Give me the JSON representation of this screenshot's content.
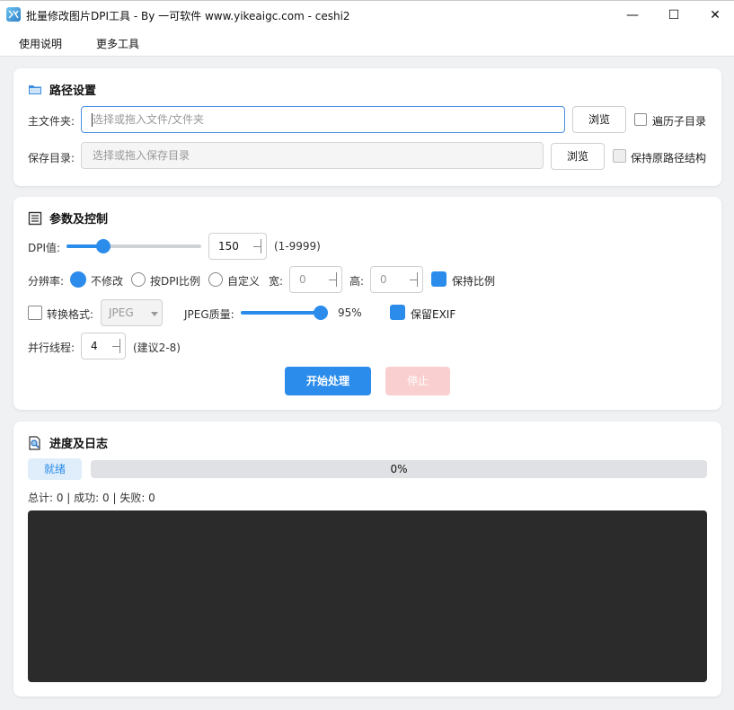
{
  "window": {
    "title": "批量修改图片DPI工具 - By 一可软件 www.yikeaigc.com - ceshi2",
    "minimize_glyph": "—",
    "maximize_glyph": "☐",
    "close_glyph": "✕"
  },
  "menu": {
    "items": [
      "使用说明",
      "更多工具"
    ]
  },
  "path_section": {
    "title": "路径设置",
    "main_label": "主文件夹:",
    "main_placeholder": "选择或拖入文件/文件夹",
    "main_browse": "浏览",
    "recurse_label": "遍历子目录",
    "recurse_checked": false,
    "save_label": "保存目录:",
    "save_placeholder": "选择或拖入保存目录",
    "save_browse": "浏览",
    "keep_structure_label": "保持原路径结构",
    "keep_structure_checked": false
  },
  "params_section": {
    "title": "参数及控制",
    "dpi_label": "DPI值:",
    "dpi_value": "150",
    "dpi_range": "(1-9999)",
    "dpi_slider_fraction": 0.27,
    "resolution_label": "分辨率:",
    "res_options": [
      "不修改",
      "按DPI比例",
      "自定义"
    ],
    "res_selected": "不修改",
    "width_label": "宽:",
    "width_value": "0",
    "height_label": "高:",
    "height_value": "0",
    "keep_ratio_label": "保持比例",
    "keep_ratio_checked": true,
    "convert_label": "转换格式:",
    "convert_checked": false,
    "format_value": "JPEG",
    "jpeg_quality_label": "JPEG质量:",
    "jpeg_quality_value": "95%",
    "jpeg_quality_fraction": 0.95,
    "keep_exif_label": "保留EXIF",
    "keep_exif_checked": true,
    "threads_label": "并行线程:",
    "threads_value": "4",
    "threads_hint": "(建议2-8)",
    "start_button": "开始处理",
    "stop_button": "停止"
  },
  "progress_section": {
    "title": "进度及日志",
    "status": "就绪",
    "progress_fraction": 0,
    "progress_text": "0%",
    "summary": "总计: 0 | 成功: 0 | 失败: 0"
  },
  "colors": {
    "accent": "#2b8ceb",
    "log_background": "#2b2b2b",
    "stop_disabled": "#f9cfcf"
  }
}
